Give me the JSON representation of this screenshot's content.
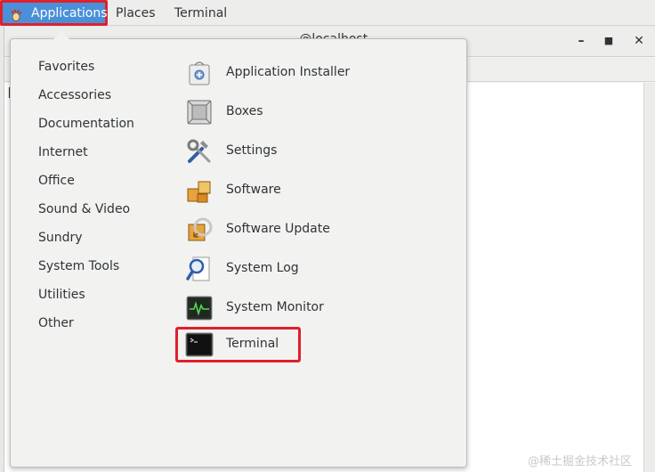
{
  "topbar": {
    "applications_label": "Applications",
    "places_label": "Places",
    "terminal_label": "Terminal"
  },
  "background_window": {
    "title_fragment": "...@localhost",
    "prompt_fragment": "["
  },
  "menu": {
    "categories": [
      "Favorites",
      "Accessories",
      "Documentation",
      "Internet",
      "Office",
      "Sound & Video",
      "Sundry",
      "System Tools",
      "Utilities",
      "Other"
    ],
    "apps": [
      {
        "label": "Application Installer",
        "icon": "package-icon"
      },
      {
        "label": "Boxes",
        "icon": "boxes-icon"
      },
      {
        "label": "Settings",
        "icon": "tools-icon"
      },
      {
        "label": "Software",
        "icon": "software-icon"
      },
      {
        "label": "Software Update",
        "icon": "software-update-icon"
      },
      {
        "label": "System Log",
        "icon": "system-log-icon"
      },
      {
        "label": "System Monitor",
        "icon": "system-monitor-icon"
      },
      {
        "label": "Terminal",
        "icon": "terminal-icon"
      }
    ]
  },
  "watermark": "@稀土掘金技术社区",
  "colors": {
    "highlight_blue": "#4a90d9",
    "annotation_red": "#e0202a"
  }
}
